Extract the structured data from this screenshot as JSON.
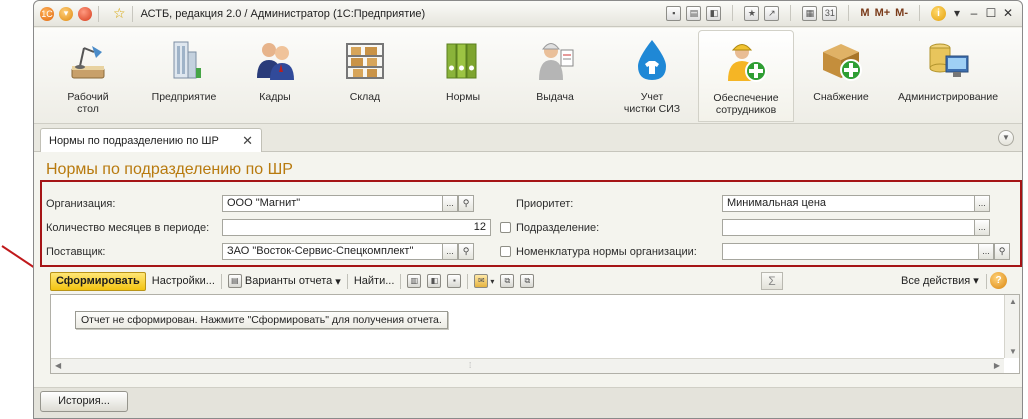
{
  "window": {
    "title": "АСТБ, редакция 2.0 / Администратор  (1С:Предприятие)",
    "toolbar_right": {
      "m": "M",
      "m_plus": "M+",
      "m_minus": "M-",
      "info": "i"
    }
  },
  "sections": [
    {
      "label": "Рабочий\nстол",
      "icon": "desk-lamp-icon"
    },
    {
      "label": "Предприятие",
      "icon": "building-icon"
    },
    {
      "label": "Кадры",
      "icon": "people-icon"
    },
    {
      "label": "Склад",
      "icon": "warehouse-shelf-icon"
    },
    {
      "label": "Нормы",
      "icon": "binders-icon"
    },
    {
      "label": "Выдача",
      "icon": "worker-icon"
    },
    {
      "label": "Учет\nчистки СИЗ",
      "icon": "water-drop-shirt-icon"
    },
    {
      "label": "Обеспечение\nсотрудников",
      "icon": "worker-plus-icon",
      "active": true
    },
    {
      "label": "Снабжение",
      "icon": "box-plus-icon"
    },
    {
      "label": "Администрирование",
      "icon": "computer-db-icon"
    }
  ],
  "tab": {
    "label": "Нормы по подразделению по ШР",
    "close": "✕"
  },
  "form": {
    "title": "Нормы по подразделению по ШР",
    "org_label": "Организация:",
    "org_value": "ООО \"Магнит\"",
    "months_label": "Количество месяцев в периоде:",
    "months_value": "12",
    "supplier_label": "Поставщик:",
    "supplier_value": "ЗАО \"Восток-Сервис-Спецкомплект\"",
    "priority_label": "Приоритет:",
    "priority_value": "Минимальная цена",
    "division_label": "Подразделение:",
    "division_value": "",
    "nomenclature_label": "Номенклатура нормы организации:",
    "nomenclature_value": "",
    "btn_dots": "...",
    "btn_search": "🔍"
  },
  "commands": {
    "generate": "Сформировать",
    "settings": "Настройки...",
    "variants": "Варианты отчета",
    "find": "Найти...",
    "sigma": "Σ",
    "all_actions": "Все действия",
    "help": "?"
  },
  "report": {
    "message": "Отчет не сформирован. Нажмите \"Сформировать\" для получения отчета."
  },
  "history_button": "История..."
}
